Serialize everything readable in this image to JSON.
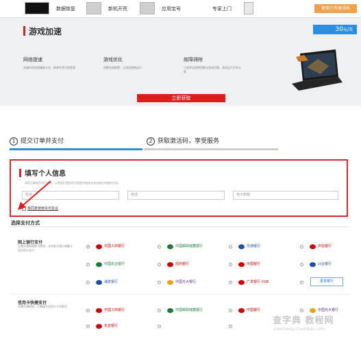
{
  "topnav": {
    "items": [
      "数据恢复",
      "新机开荒",
      "应用宝号",
      "专家上门"
    ],
    "cta": "使用已有激活码"
  },
  "banner": {
    "title": "游戏加速",
    "price": "30",
    "price_unit": "元/次",
    "features": [
      {
        "title": "网络提速",
        "desc": "关键时刻网速慢被卡住，联想专家为您提速"
      },
      {
        "title": "游戏优化",
        "desc": "调整系统配置，让游戏更畅运行"
      },
      {
        "title": "故障排除",
        "desc": "工程师远程帮您解决游戏问题，游戏运行不再卡顿"
      }
    ],
    "get_button": "立即获取"
  },
  "steps": [
    {
      "num": "1",
      "label": "提交订单并支付",
      "active": true
    },
    {
      "num": "2",
      "label": "获取激活码，享受服务",
      "active": false
    }
  ],
  "form": {
    "title": "填写个人信息",
    "hint": "请您正确填写用户信息，以便我们更好的为您提供服务并发送相应的服务信息。",
    "fields": [
      "姓名",
      "电话",
      "电子邮箱"
    ],
    "agree": "我同意使用许可协议"
  },
  "payment": {
    "title": "选择支付方式",
    "groups": [
      {
        "title": "网上银行支付",
        "desc": "无需开通网银即可使用，支持各大银行储蓄卡及信用卡支付"
      },
      {
        "title": "信用卡快捷支付",
        "desc": "无需开通网银，只需填写信用卡卡号即可"
      }
    ],
    "banks_row1": [
      "中国工商银行",
      "中国邮政储蓄银行",
      "交通银行",
      "中信银行"
    ],
    "banks_row2": [
      "中国农业银行",
      "招商银行",
      "中国银行",
      "兴业银行"
    ],
    "banks_row3": [
      "浦发银行",
      "中国光大银行",
      "广发银行 CGB"
    ],
    "banks_credit_row1": [
      "中国工商银行",
      "中国邮政储蓄银行",
      "中国银行",
      "中国光大银行"
    ],
    "banks_credit_row2": [
      "东亚银行"
    ],
    "more": "更多银行"
  },
  "watermark": {
    "main": "查字典 教程网",
    "sub": "jiaocheng.chazidian.com"
  },
  "colors": {
    "accent": "#e01c1c",
    "blue": "#2d8ee0",
    "orange": "#f0a04b"
  }
}
